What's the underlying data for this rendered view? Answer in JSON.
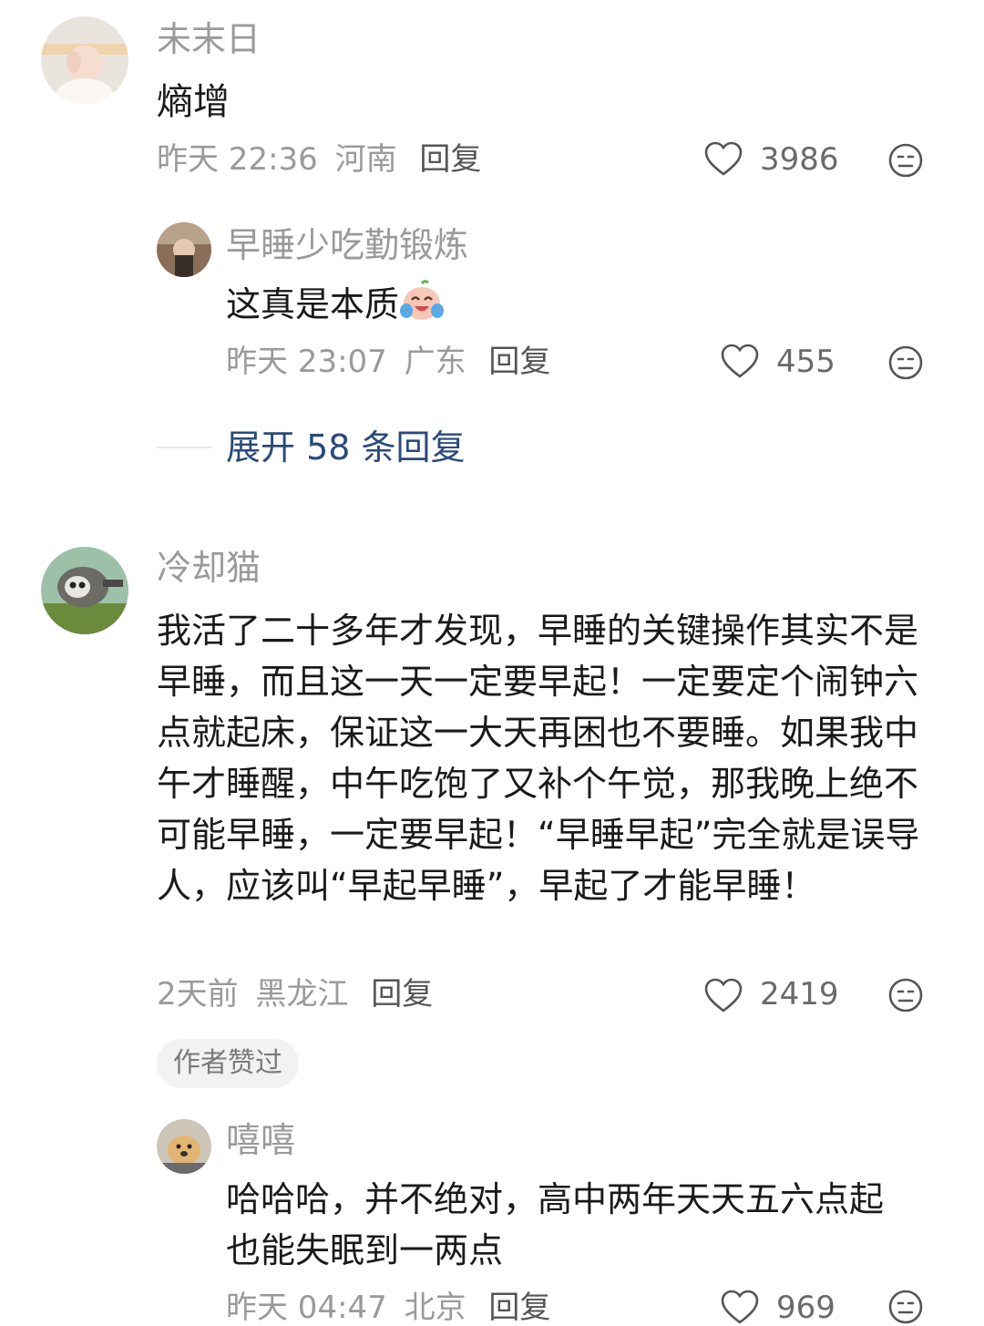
{
  "comments": [
    {
      "name": "未末日",
      "text": "熵增",
      "time": "昨天 22:36",
      "location": "河南",
      "reply": "回复",
      "likes": "3986"
    },
    {
      "name": "早睡少吃勤锻炼",
      "text": "这真是本质",
      "time": "昨天 23:07",
      "location": "广东",
      "reply": "回复",
      "likes": "455",
      "emoji": "laughing-crying-face-icon"
    },
    {
      "expand": "展开 58 条回复"
    },
    {
      "name": "冷却猫",
      "text": "我活了二十多年才发现，早睡的关键操作其实不是早睡，而且这一天一定要早起！一定要定个闹钟六点就起床，保证这一大天再困也不要睡。如果我中午才睡醒，中午吃饱了又补个午觉，那我晚上绝不可能早睡，一定要早起！“早睡早起”完全就是误导人，应该叫“早起早睡”，早起了才能早睡！",
      "time": "2天前",
      "location": "黑龙江",
      "reply": "回复",
      "likes": "2419",
      "badge": "作者赞过"
    },
    {
      "name": "嘻嘻",
      "text": "哈哈哈，并不绝对，高中两年天天五六点起 也能失眠到一两点",
      "time": "昨天 04:47",
      "location": "北京",
      "reply": "回复",
      "likes": "969"
    }
  ],
  "colors": {
    "name": "#9a9a9a",
    "text": "#1a1a1a",
    "meta": "#9a9a9a",
    "expand": "#2a4a7a",
    "badge_bg": "#f2f2f2"
  }
}
